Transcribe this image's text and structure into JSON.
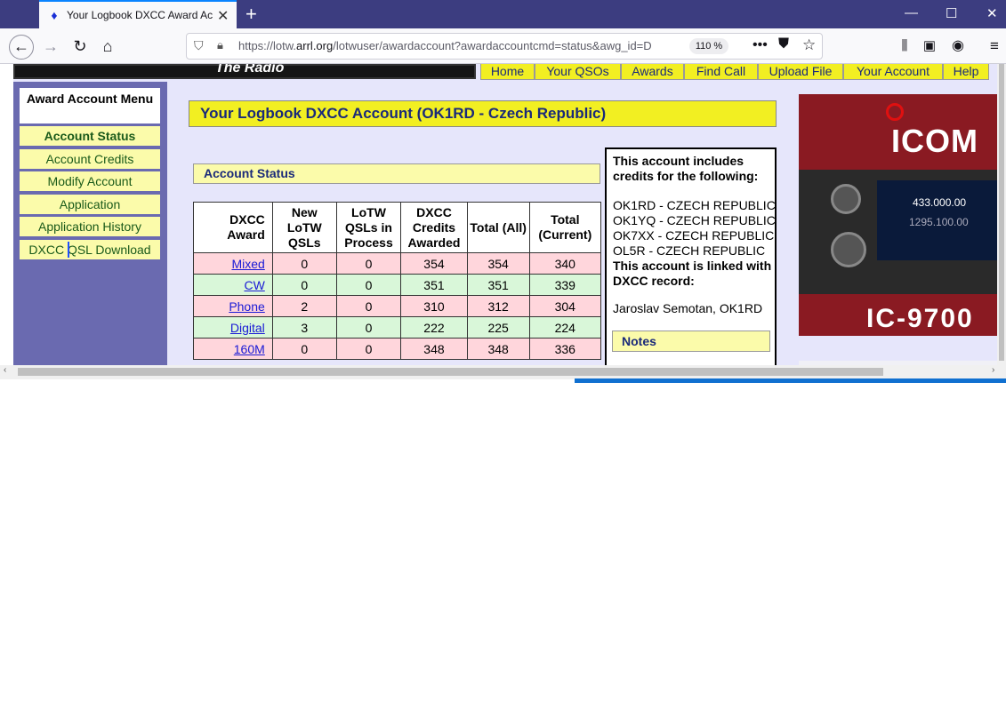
{
  "browser": {
    "tab_title": "Your Logbook DXCC Award Ac",
    "url_prefix": "https://lotw.",
    "url_domain": "arrl.org",
    "url_rest": "/lotwuser/awardaccount?awardaccountcmd=status&awg_id=D",
    "zoom": "110 %"
  },
  "topnav": {
    "banner_text": "The Radio",
    "items": [
      "Home",
      "Your QSOs",
      "Awards",
      "Find Call",
      "Upload File",
      "Your Account",
      "Help"
    ]
  },
  "menu": {
    "title": "Award Account Menu",
    "items": [
      "Account Status",
      "Account Credits",
      "Modify Account",
      "Application",
      "Application History",
      "DXCC QSL Download"
    ]
  },
  "main": {
    "title": "Your Logbook DXCC Account (OK1RD - Czech Republic)",
    "section_header": "Account Status",
    "table": {
      "headers": [
        "DXCC Award",
        "New LoTW QSLs",
        "LoTW QSLs in Process",
        "DXCC Credits Awarded",
        "Total (All)",
        "Total (Current)"
      ],
      "rows": [
        {
          "award": "Mixed",
          "new": "0",
          "process": "0",
          "awarded": "354",
          "all": "354",
          "current": "340"
        },
        {
          "award": "CW",
          "new": "0",
          "process": "0",
          "awarded": "351",
          "all": "351",
          "current": "339"
        },
        {
          "award": "Phone",
          "new": "2",
          "process": "0",
          "awarded": "310",
          "all": "312",
          "current": "304"
        },
        {
          "award": "Digital",
          "new": "3",
          "process": "0",
          "awarded": "222",
          "all": "225",
          "current": "224"
        },
        {
          "award": "160M",
          "new": "0",
          "process": "0",
          "awarded": "348",
          "all": "348",
          "current": "336"
        }
      ]
    }
  },
  "sidebox": {
    "includes_title": "This account includes credits for the following:",
    "calls": [
      "OK1RD - CZECH REPUBLIC",
      "OK1YQ - CZECH REPUBLIC",
      "OK7XX - CZECH REPUBLIC",
      "OL5R - CZECH REPUBLIC"
    ],
    "linked_title": "This account is linked with DXCC record:",
    "linked_record": "Jaroslav Semotan, OK1RD",
    "notes_label": "Notes"
  },
  "ad": {
    "brand": "ICOM",
    "model": "IC-9700",
    "freq1": "433.000.00",
    "freq2": "1295.100.00"
  },
  "colors": {
    "accent_yellow": "#f2ef22",
    "menu_bg": "#6a6ab0",
    "row_pink": "#ffd6dc",
    "row_green": "#d9f7d9"
  }
}
